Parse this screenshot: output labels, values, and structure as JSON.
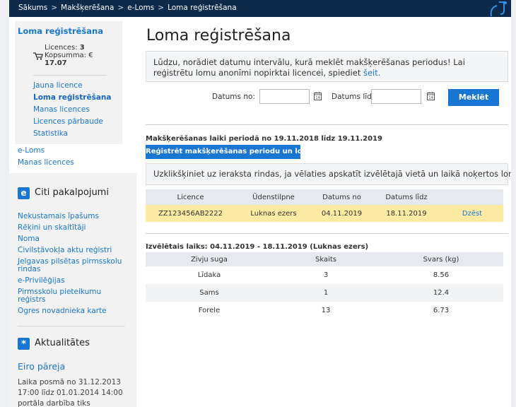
{
  "breadcrumbs": [
    "Sākums",
    "Makšķerēšana",
    "e-Loms",
    "Loma reģistrēšana"
  ],
  "sidebar": {
    "box_title": "Loma reģistrēšana",
    "cart": {
      "licences_label": "Licences:",
      "licences_count": "3",
      "sum_label": "Kopsumma: €",
      "sum_value": "17.07"
    },
    "links": [
      {
        "label": "Jauna licence",
        "active": false
      },
      {
        "label": "Loma reģistrēšana",
        "active": true
      },
      {
        "label": "Manas licences",
        "active": false
      },
      {
        "label": "Licences pārbaude",
        "active": false
      },
      {
        "label": "Statistika",
        "active": false
      }
    ],
    "outer_links": [
      "e-Loms",
      "Manas licences"
    ]
  },
  "other_services": {
    "title": "Citi pakalpojumi",
    "icon_letter": "e",
    "links": [
      "Nekustamais īpašums",
      "Rēķini un skaitītāji",
      "Noma",
      "Civilstāvokļa aktu reģistri",
      "Jelgavas pilsētas pirmsskolu rindas",
      "e-Privilēģijas",
      "Pirmsskolu pieteikumu reģistrs",
      "Ogres novadnieka karte"
    ]
  },
  "news": {
    "title": "Aktualitātes",
    "item_title": "Eiro pāreja",
    "item_text": "Laika posmā no 31.12.2013 17:00 līdz 01.01.2014 14:00 portāla darbība tiks apturēta"
  },
  "main": {
    "title": "Loma reģistrēšana",
    "info_text": "Lūdzu, norādiet datumu intervālu, kurā meklēt makšķerēšanas periodus! Lai reģistrētu lomu anonīmi nopirktai licencei, spiediet",
    "info_link": "šeit.",
    "date_from_label": "Datums no:",
    "date_to_label": "Datums līdz:",
    "date_from_value": "",
    "date_to_value": "",
    "search_label": "Meklēt",
    "period_title": "Makšķerēšanas laiki periodā no 19.11.2018 līdz 19.11.2019",
    "register_label": "Reģistrēt makšķerēšanas periodu un lomu",
    "hint_text": "Uzklikšķiniet uz ieraksta rindas, ja vēlaties apskatīt izvēlētajā vietā un laikā noķertos lomus!",
    "periods": {
      "headers": [
        "Licence",
        "Ūdenstilpne",
        "Datums no",
        "Datums līdz",
        ""
      ],
      "rows": [
        [
          "ZZ123456AB2222",
          "Luknas ezers",
          "04.11.2019",
          "18.11.2019",
          "Dzēst"
        ]
      ]
    },
    "selected_title": "Izvēlētais laiks: 04.11.2019 - 18.11.2019 (Luknas ezers)",
    "catch": {
      "headers": [
        "Zivju suga",
        "Skaits",
        "Svars (kg)"
      ],
      "rows": [
        [
          "Līdaka",
          "3",
          "8.56"
        ],
        [
          "Sams",
          "1",
          "12.4"
        ],
        [
          "Forele",
          "13",
          "6.73"
        ]
      ]
    }
  }
}
